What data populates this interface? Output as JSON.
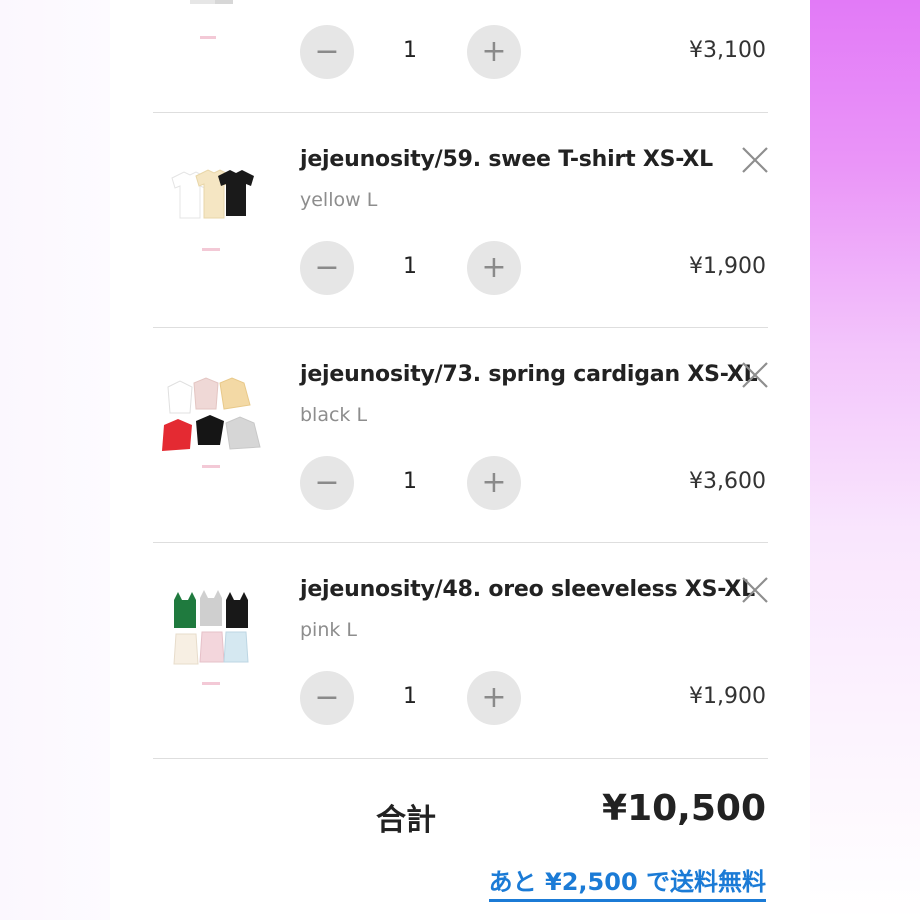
{
  "cart": {
    "items": [
      {
        "title": "",
        "variant": "",
        "quantity": "1",
        "price": "¥3,100",
        "thumb_icon": "product-thumbnail-partial"
      },
      {
        "title": "jejeunosity/59. swee T-shirt XS-XL",
        "variant": "yellow L",
        "quantity": "1",
        "price": "¥1,900",
        "thumb_icon": "tshirt-thumbnail"
      },
      {
        "title": "jejeunosity/73. spring cardigan XS-XL",
        "variant": "black L",
        "quantity": "1",
        "price": "¥3,600",
        "thumb_icon": "cardigan-thumbnail"
      },
      {
        "title": "jejeunosity/48. oreo sleeveless XS-XL",
        "variant": "pink L",
        "quantity": "1",
        "price": "¥1,900",
        "thumb_icon": "sleeveless-thumbnail"
      }
    ],
    "minus_symbol": "−",
    "plus_symbol": "+",
    "total_label": "合計",
    "total_value": "¥10,500",
    "free_shipping_message": "あと ¥2,500 で送料無料"
  },
  "colors": {
    "accent_link": "#1b7bd6",
    "qty_button_bg": "#e6e6e6",
    "right_gradient_top": "#e27af7"
  }
}
